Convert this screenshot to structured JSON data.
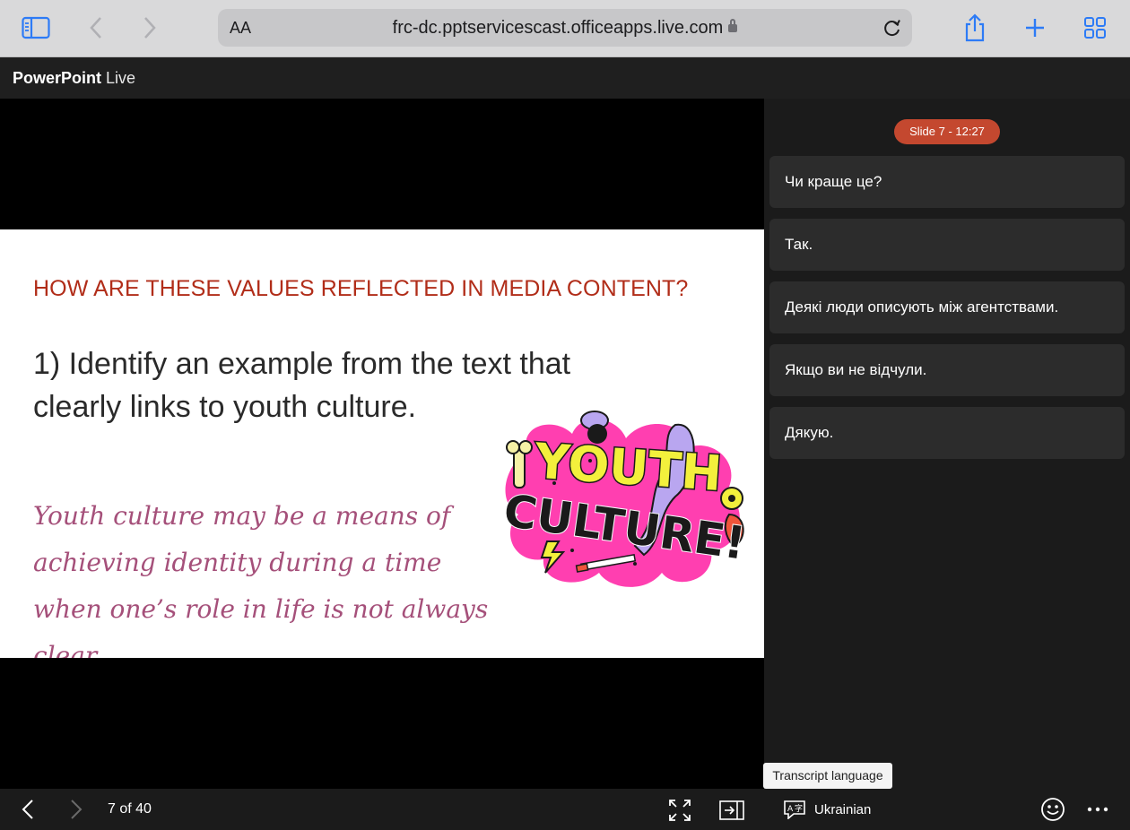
{
  "browser": {
    "url": "frc-dc.pptservicescast.officeapps.live.com",
    "text_size_label": "AA",
    "icons": [
      "sidebar-icon",
      "back-icon",
      "forward-icon",
      "lock-icon",
      "reload-icon",
      "share-icon",
      "new-tab-icon",
      "tabs-overview-icon"
    ]
  },
  "app": {
    "brand_bold": "PowerPoint",
    "brand_light": "Live"
  },
  "slide": {
    "heading": "HOW ARE THESE VALUES REFLECTED IN MEDIA CONTENT?",
    "point": "1) Identify an example from the text that clearly links to youth culture.",
    "quote": "Youth culture may be a means of achieving identity during a time when one’s role in life is not always clear",
    "sticker_line1": "YOUTH",
    "sticker_line2": "CULTURE!",
    "colors": {
      "heading": "#b12d19",
      "quote": "#a5507a",
      "sticker_pink": "#ff3fb0",
      "sticker_yellow": "#f3f03c"
    }
  },
  "transcript": {
    "badge": "Slide 7 - 12:27",
    "badge_color": "#c4482f",
    "messages": [
      "Чи краще це?",
      "Так.",
      "Деякі люди описують між агентствами.",
      "Якщо ви не відчули.",
      "Дякую."
    ]
  },
  "footer": {
    "page_indicator": "7 of 40",
    "language": "Ukrainian",
    "tooltip": "Transcript language"
  }
}
